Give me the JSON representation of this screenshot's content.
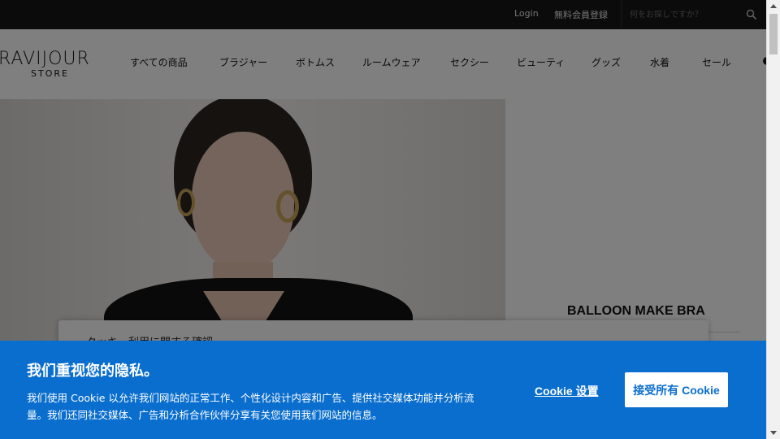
{
  "topbar": {
    "login": "Login",
    "register": "無料会員登録",
    "search_placeholder": "何をお探しですか？",
    "search_icon": "search-icon"
  },
  "header": {
    "logo_main": "RAVIJOUR",
    "logo_sub": "STORE",
    "nav": [
      "すべての商品",
      "ブラジャー",
      "ボトムス",
      "ルームウェア",
      "セクシー",
      "ビューティ",
      "グッズ",
      "水着",
      "セール"
    ]
  },
  "content": {
    "product_title": "BALLOON MAKE BRA",
    "cookie_card_title": "クッキー利用に関する確認"
  },
  "consent": {
    "title": "我们重视您的隐私。",
    "description": "我们使用 Cookie 以允许我们网站的正常工作、个性化设计内容和广告、提供社交媒体功能并分析流量。我们还同社交媒体、广告和分析合作伙伴分享有关您使用我们网站的信息。",
    "settings_label": "Cookie 设置",
    "accept_label": "接受所有 Cookie",
    "accent_color": "#0a6ece"
  }
}
